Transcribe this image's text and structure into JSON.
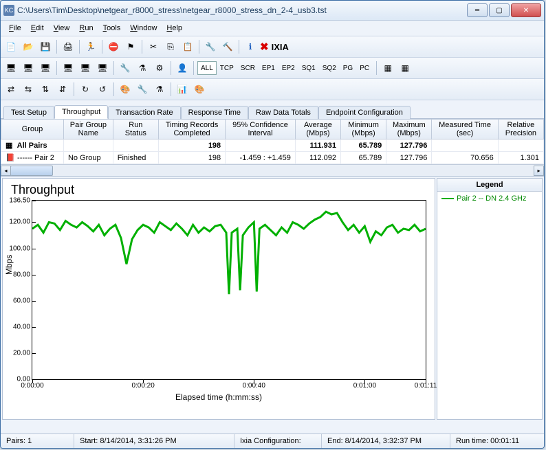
{
  "window": {
    "icon": "KC",
    "title": "C:\\Users\\Tim\\Desktop\\netgear_r8000_stress\\netgear_r8000_stress_dn_2-4_usb3.tst"
  },
  "menu": [
    "File",
    "Edit",
    "View",
    "Run",
    "Tools",
    "Window",
    "Help"
  ],
  "toolbar2_text": [
    "ALL",
    "TCP",
    "SCR",
    "EP1",
    "EP2",
    "SQ1",
    "SQ2",
    "PG",
    "PC"
  ],
  "brand": "IXIA",
  "tabs": [
    "Test Setup",
    "Throughput",
    "Transaction Rate",
    "Response Time",
    "Raw Data Totals",
    "Endpoint Configuration"
  ],
  "active_tab": 1,
  "grid": {
    "headers": [
      "Group",
      "Pair Group Name",
      "Run Status",
      "Timing Records Completed",
      "95% Confidence Interval",
      "Average (Mbps)",
      "Minimum (Mbps)",
      "Maximum (Mbps)",
      "Measured Time (sec)",
      "Relative Precision"
    ],
    "rows": [
      {
        "bold": true,
        "cells": [
          "All Pairs",
          "",
          "",
          "198",
          "",
          "111.931",
          "65.789",
          "127.796",
          "",
          ""
        ]
      },
      {
        "bold": false,
        "cells": [
          "Pair 2",
          "No Group",
          "Finished",
          "198",
          "-1.459 : +1.459",
          "112.092",
          "65.789",
          "127.796",
          "70.656",
          "1.301"
        ]
      }
    ]
  },
  "chart_data": {
    "type": "line",
    "title": "Throughput",
    "xlabel": "Elapsed time (h:mm:ss)",
    "ylabel": "Mbps",
    "ylim": [
      0,
      136.5
    ],
    "yticks": [
      0,
      20,
      40,
      60,
      80,
      100,
      120,
      136.5
    ],
    "yticklabels": [
      "0.00",
      "20.00",
      "40.00",
      "60.00",
      "80.00",
      "100.00",
      "120.00",
      "136.50"
    ],
    "xticks": [
      0,
      20,
      40,
      60,
      71
    ],
    "xticklabels": [
      "0:00:00",
      "0:00:20",
      "0:00:40",
      "0:01:00",
      "0:01:11"
    ],
    "xrange": [
      0,
      71
    ],
    "series": [
      {
        "name": "Pair 2 -- DN 2.4 GHz",
        "color": "#00b000",
        "x": [
          0,
          1,
          2,
          3,
          4,
          5,
          6,
          7,
          8,
          9,
          10,
          11,
          12,
          13,
          14,
          15,
          16,
          17,
          18,
          19,
          20,
          21,
          22,
          23,
          24,
          25,
          26,
          27,
          28,
          29,
          30,
          31,
          32,
          33,
          34,
          35,
          35.5,
          36,
          37,
          37.5,
          38,
          39,
          40,
          40.5,
          41,
          42,
          43,
          44,
          45,
          46,
          47,
          48,
          49,
          50,
          51,
          52,
          53,
          54,
          55,
          56,
          57,
          58,
          59,
          60,
          61,
          62,
          63,
          64,
          65,
          66,
          67,
          68,
          69,
          70,
          71
        ],
        "values": [
          115,
          118,
          112,
          120,
          119,
          114,
          121,
          118,
          116,
          120,
          117,
          113,
          118,
          110,
          115,
          118,
          108,
          88,
          107,
          114,
          118,
          116,
          112,
          120,
          117,
          114,
          119,
          115,
          110,
          118,
          112,
          116,
          113,
          117,
          118,
          112,
          65,
          112,
          115,
          68,
          110,
          116,
          120,
          67,
          115,
          118,
          114,
          110,
          116,
          112,
          120,
          118,
          115,
          119,
          122,
          124,
          128,
          126,
          127,
          120,
          114,
          118,
          112,
          117,
          105,
          113,
          110,
          116,
          118,
          112,
          115,
          114,
          118,
          113,
          115
        ]
      }
    ]
  },
  "legend": {
    "title": "Legend"
  },
  "status": {
    "pairs": "Pairs: 1",
    "start": "Start: 8/14/2014, 3:31:26 PM",
    "config": "Ixia Configuration:",
    "end": "End: 8/14/2014, 3:32:37 PM",
    "runtime": "Run time: 00:01:11"
  }
}
